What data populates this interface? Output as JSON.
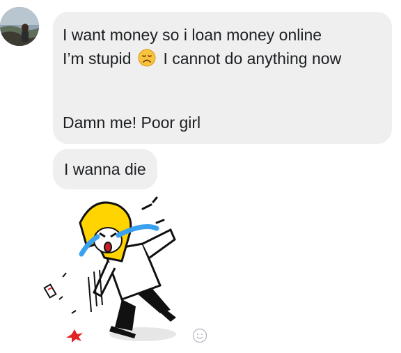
{
  "chat": {
    "avatar_icon": "profile-photo",
    "messages": [
      {
        "line1": "I want money so i loan money online",
        "line2_before_emoji": "I’m stupid",
        "emoji_icon": "disappointed-face-emoji",
        "line2_after_emoji": "I cannot do anything now",
        "line3": "Damn me! Poor girl"
      },
      {
        "text": "I wanna die"
      }
    ],
    "sticker_icon": "crying-girl-sticker",
    "reaction_icon": "smiley-face-icon",
    "colors": {
      "bubble": "#efefef",
      "text": "#1c1e21",
      "sticker_hair": "#ffd400",
      "sticker_tears": "#3aa0f0"
    }
  }
}
